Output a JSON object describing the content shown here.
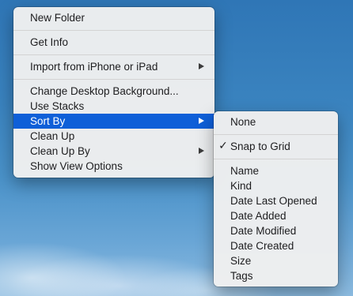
{
  "main_menu": {
    "items": [
      {
        "label": "New Folder"
      },
      {
        "label": "Get Info"
      },
      {
        "label": "Import from iPhone or iPad"
      },
      {
        "label": "Change Desktop Background..."
      },
      {
        "label": "Use Stacks"
      },
      {
        "label": "Sort By"
      },
      {
        "label": "Clean Up"
      },
      {
        "label": "Clean Up By"
      },
      {
        "label": "Show View Options"
      }
    ]
  },
  "sort_submenu": {
    "items": [
      {
        "label": "None"
      },
      {
        "label": "Snap to Grid",
        "checked": true,
        "check_glyph": "✓"
      },
      {
        "label": "Name"
      },
      {
        "label": "Kind"
      },
      {
        "label": "Date Last Opened"
      },
      {
        "label": "Date Added"
      },
      {
        "label": "Date Modified"
      },
      {
        "label": "Date Created"
      },
      {
        "label": "Size"
      },
      {
        "label": "Tags"
      }
    ]
  },
  "colors": {
    "highlight": "#0e5fd8",
    "menu_background": "#f0f0f0",
    "desktop_sky": "#3a83bf"
  }
}
